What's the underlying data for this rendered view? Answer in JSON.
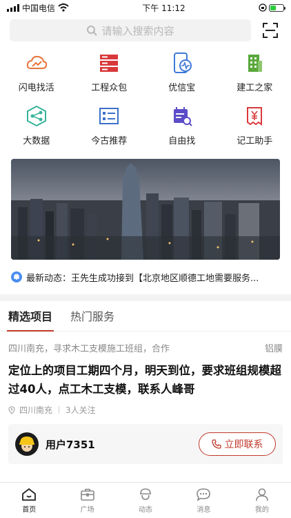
{
  "status": {
    "carrier": "中国电信",
    "time": "下午 11:12"
  },
  "search": {
    "placeholder": "请输入搜索内容"
  },
  "shortcuts": [
    {
      "label": "闪电找活",
      "icon": "cloud-chart-icon",
      "color": "#e8733a"
    },
    {
      "label": "工程众包",
      "icon": "server-stack-icon",
      "color": "#d9383a"
    },
    {
      "label": "优信宝",
      "icon": "phone-pulse-icon",
      "color": "#3d78d8"
    },
    {
      "label": "建工之家",
      "icon": "building-icon",
      "color": "#5aa83c"
    },
    {
      "label": "大数据",
      "icon": "network-hexagon-icon",
      "color": "#36b39a"
    },
    {
      "label": "今古推荐",
      "icon": "list-card-icon",
      "color": "#3d6fc9"
    },
    {
      "label": "自由找",
      "icon": "calendar-search-icon",
      "color": "#5b4cc8"
    },
    {
      "label": "记工助手",
      "icon": "receipt-yuan-icon",
      "color": "#d9383a"
    }
  ],
  "news": {
    "text": "最新动态：王先生成功接到【北京地区顺德工地需要服务..."
  },
  "tabs": [
    {
      "label": "精选项目",
      "active": true
    },
    {
      "label": "热门服务",
      "active": false
    }
  ],
  "project": {
    "meta": "四川南充，寻求木工支模施工班组，合作",
    "tag": "铝膜",
    "title": "定位上的项目工期四个月，明天到位，要求班组规模超过40人，点工木工支模，联系人峰哥",
    "location": "四川南充",
    "followers": "3人关注",
    "user": "用户7351",
    "contact_label": "立即联系"
  },
  "tabbar": [
    {
      "label": "首页",
      "icon": "home-icon",
      "active": true
    },
    {
      "label": "广场",
      "icon": "briefcase-icon",
      "active": false
    },
    {
      "label": "动态",
      "icon": "worker-icon",
      "active": false
    },
    {
      "label": "消息",
      "icon": "chat-icon",
      "active": false
    },
    {
      "label": "我的",
      "icon": "user-icon",
      "active": false
    }
  ],
  "colors": {
    "accent": "#c0392b"
  }
}
